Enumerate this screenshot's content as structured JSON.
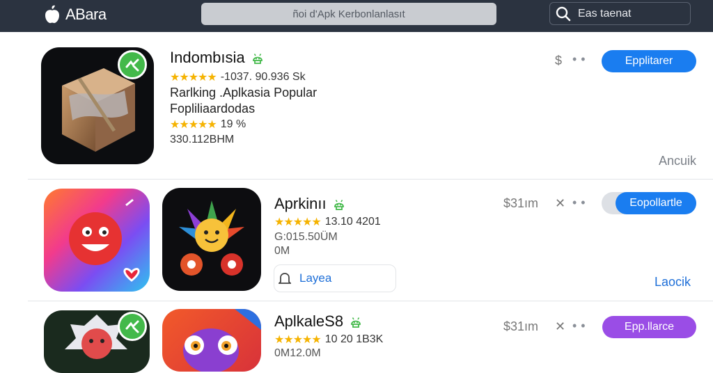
{
  "topbar": {
    "logo_text": "ABara",
    "url_text": "ñoi d'Apk Kerbonlanlasıt",
    "search_placeholder": "Eas taenat"
  },
  "apps": [
    {
      "title": "Indombısia",
      "rating_text": "-1037. 90.936 Sk",
      "subtitle_1": "Rarlking .Aplkasia Popular",
      "subtitle_2": "Fopliliaardodas",
      "rating2_text": "19 %",
      "size_text": "330.112BHM",
      "button_label": "Epplitarer",
      "side_link": "Ancuik"
    },
    {
      "title": "Aprkinıı",
      "rating_text": "13.10 4201",
      "size_text": "G:015.50ÜM",
      "size2_text": "0M",
      "chip_label": "Layea",
      "price_text": "$31ım",
      "button_label": "Eopollartle",
      "side_link": "Laocik"
    },
    {
      "title": "AplkaleS8",
      "rating_text": "10 20 1B3K",
      "size_text": "0M12.0M",
      "price_text": "$31ım",
      "button_label": "Epp.llarce"
    }
  ],
  "colors": {
    "topbar": "#2b3340",
    "button_blue": "#1a7df0",
    "button_purple": "#9a4de6",
    "star": "#f5b301",
    "verify_green": "#43b94a"
  }
}
